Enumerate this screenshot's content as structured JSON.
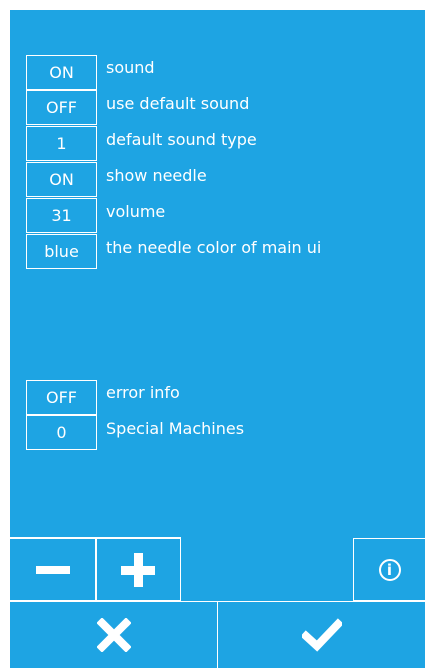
{
  "settings_primary": [
    {
      "value": "ON",
      "label": "sound"
    },
    {
      "value": "OFF",
      "label": "use default sound"
    },
    {
      "value": "1",
      "label": "default sound type"
    },
    {
      "value": "ON",
      "label": "show needle"
    },
    {
      "value": "31",
      "label": "volume"
    },
    {
      "value": "blue",
      "label": "the needle color of main ui"
    }
  ],
  "settings_secondary": [
    {
      "value": "OFF",
      "label": "error info"
    },
    {
      "value": "0",
      "label": "Special Machines"
    }
  ],
  "toolbar": {
    "minus_icon": "minus-icon",
    "plus_icon": "plus-icon",
    "info_icon": "info-icon",
    "info_glyph": "i"
  },
  "footer": {
    "cancel_icon": "close-icon",
    "confirm_icon": "checkmark-icon"
  },
  "colors": {
    "background": "#1ea4e3",
    "foreground": "#ffffff"
  }
}
